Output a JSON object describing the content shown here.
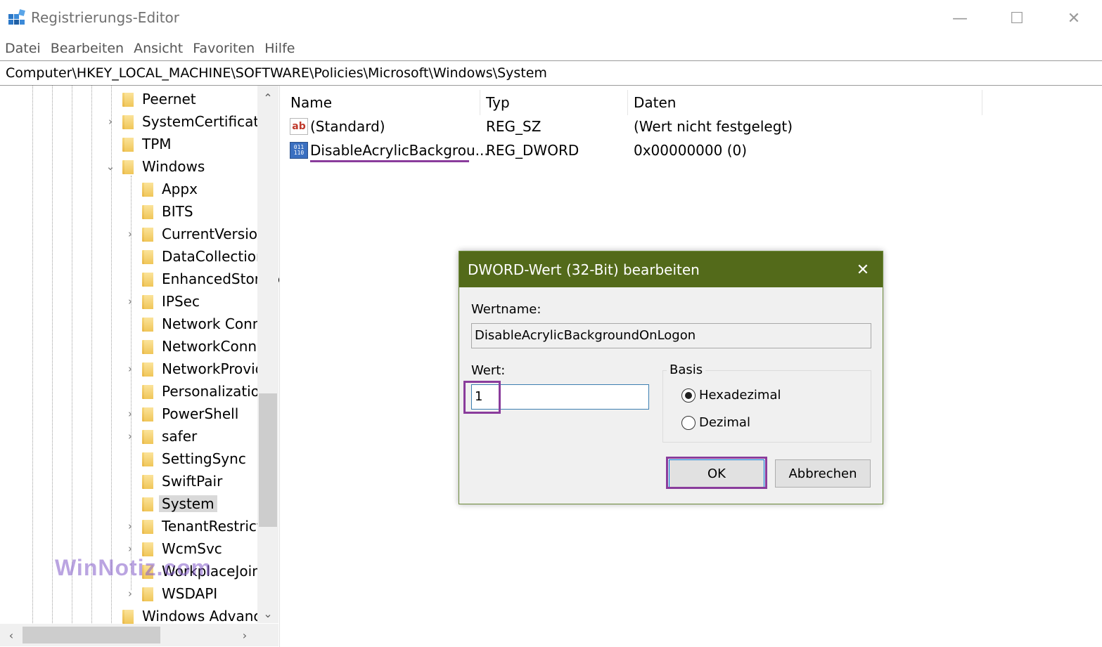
{
  "window": {
    "title": "Registrierungs-Editor",
    "minimize": "—",
    "maximize": "☐",
    "close": "✕"
  },
  "menu": [
    "Datei",
    "Bearbeiten",
    "Ansicht",
    "Favoriten",
    "Hilfe"
  ],
  "address": "Computer\\HKEY_LOCAL_MACHINE\\SOFTWARE\\Policies\\Microsoft\\Windows\\System",
  "tree": {
    "items": [
      {
        "label": "Peernet",
        "expander": "",
        "level": 1
      },
      {
        "label": "SystemCertificates",
        "expander": "›",
        "level": 1
      },
      {
        "label": "TPM",
        "expander": "",
        "level": 1
      },
      {
        "label": "Windows",
        "expander": "⌄",
        "level": 1
      },
      {
        "label": "Appx",
        "expander": "",
        "level": 2
      },
      {
        "label": "BITS",
        "expander": "",
        "level": 2
      },
      {
        "label": "CurrentVersion",
        "expander": "›",
        "level": 2
      },
      {
        "label": "DataCollection",
        "expander": "",
        "level": 2
      },
      {
        "label": "EnhancedStorage",
        "expander": "",
        "level": 2
      },
      {
        "label": "IPSec",
        "expander": "›",
        "level": 2
      },
      {
        "label": "Network Conn",
        "expander": "",
        "level": 2
      },
      {
        "label": "NetworkConne",
        "expander": "",
        "level": 2
      },
      {
        "label": "NetworkProvid",
        "expander": "›",
        "level": 2
      },
      {
        "label": "Personalization",
        "expander": "",
        "level": 2
      },
      {
        "label": "PowerShell",
        "expander": "›",
        "level": 2
      },
      {
        "label": "safer",
        "expander": "›",
        "level": 2
      },
      {
        "label": "SettingSync",
        "expander": "",
        "level": 2
      },
      {
        "label": "SwiftPair",
        "expander": "",
        "level": 2
      },
      {
        "label": "System",
        "expander": "",
        "level": 2,
        "selected": true
      },
      {
        "label": "TenantRestricti",
        "expander": "›",
        "level": 2
      },
      {
        "label": "WcmSvc",
        "expander": "›",
        "level": 2
      },
      {
        "label": "WorkplaceJoin",
        "expander": "",
        "level": 2
      },
      {
        "label": "WSDAPI",
        "expander": "›",
        "level": 2
      },
      {
        "label": "Windows Advanc",
        "expander": "",
        "level": 1
      }
    ],
    "scroll_up": "⌃",
    "scroll_down": "⌄",
    "scroll_left": "‹",
    "scroll_right": "›"
  },
  "watermark": "WinNotiz.com",
  "list": {
    "columns": [
      "Name",
      "Typ",
      "Daten"
    ],
    "rows": [
      {
        "icon": "string-value-icon",
        "name": "(Standard)",
        "type": "REG_SZ",
        "data": "(Wert nicht festgelegt)"
      },
      {
        "icon": "binary-value-icon",
        "name": "DisableAcrylicBackgrou...",
        "type": "REG_DWORD",
        "data": "0x00000000 (0)"
      }
    ]
  },
  "dialog": {
    "title": "DWORD-Wert (32-Bit) bearbeiten",
    "close": "✕",
    "name_label": "Wertname:",
    "name_value": "DisableAcrylicBackgroundOnLogon",
    "value_label": "Wert:",
    "value": "1",
    "base_label": "Basis",
    "base_options": [
      {
        "label": "Hexadezimal",
        "checked": true
      },
      {
        "label": "Dezimal",
        "checked": false
      }
    ],
    "ok": "OK",
    "cancel": "Abbrechen"
  },
  "colors": {
    "dialog_title_bg": "#536a1a",
    "highlight": "#8a3c9c",
    "folder": "#f0c658",
    "selected_bg": "#d9d9d9"
  }
}
